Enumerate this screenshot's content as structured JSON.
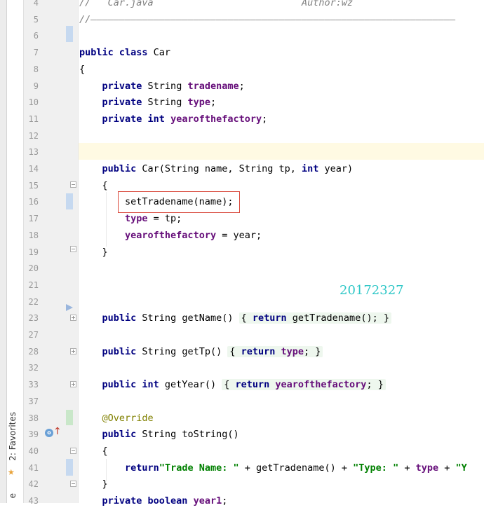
{
  "sidebar": {
    "favorites_label": "2: Favorites",
    "edge_label": "e"
  },
  "watermark": "20172327",
  "lines": [
    {
      "n": "4",
      "html": "<span class=\"cmt\">//   Car.java                          Author:wz</span>"
    },
    {
      "n": "5",
      "html": "<span class=\"cmt\">//————————————————————————————————————————————————————————————————</span>"
    },
    {
      "n": "6",
      "html": ""
    },
    {
      "n": "7",
      "html": "<span class=\"kw\">public class</span> Car"
    },
    {
      "n": "8",
      "html": "{"
    },
    {
      "n": "9",
      "html": "    <span class=\"kw\">private</span> String <span class=\"fld\">tradename</span>;"
    },
    {
      "n": "10",
      "html": "    <span class=\"kw\">private</span> String <span class=\"fld\">type</span>;"
    },
    {
      "n": "11",
      "html": "    <span class=\"kw\">private int</span> <span class=\"fld\">yearofthefactory</span>;"
    },
    {
      "n": "12",
      "html": ""
    },
    {
      "n": "13",
      "html": ""
    },
    {
      "n": "14",
      "html": "    <span class=\"kw\">public</span> Car(String name, String tp, <span class=\"kw\">int</span> year)"
    },
    {
      "n": "15",
      "html": "    {"
    },
    {
      "n": "16",
      "html": "        setTradename(name);"
    },
    {
      "n": "17",
      "html": "        <span class=\"fld\">type</span> = tp;"
    },
    {
      "n": "18",
      "html": "        <span class=\"fld\">yearofthefactory</span> = year;"
    },
    {
      "n": "19",
      "html": "    }"
    },
    {
      "n": "20",
      "html": ""
    },
    {
      "n": "21",
      "html": ""
    },
    {
      "n": "22",
      "html": ""
    },
    {
      "n": "23",
      "html": "    <span class=\"kw\">public</span> String getName() <span class=\"collapsed\">{ <span class=\"kw\">return</span> getTradename(); }</span>"
    },
    {
      "n": "27",
      "html": ""
    },
    {
      "n": "28",
      "html": "    <span class=\"kw\">public</span> String getTp() <span class=\"collapsed\">{ <span class=\"kw\">return</span> <span class=\"fld\">type</span>; }</span>"
    },
    {
      "n": "32",
      "html": ""
    },
    {
      "n": "33",
      "html": "    <span class=\"kw\">public int</span> getYear() <span class=\"collapsed\">{ <span class=\"kw\">return</span> <span class=\"fld\">yearofthefactory</span>; }</span>"
    },
    {
      "n": "37",
      "html": ""
    },
    {
      "n": "38",
      "html": "    <span class=\"ann\">@Override</span>"
    },
    {
      "n": "39",
      "html": "    <span class=\"kw\">public</span> String toString()"
    },
    {
      "n": "40",
      "html": "    {"
    },
    {
      "n": "41",
      "html": "        <span class=\"kw\">return</span><span class=\"str\">\"Trade Name: \"</span> + getTradename() + <span class=\"str\">\"Type: \"</span> + <span class=\"fld\">type</span> + <span class=\"str\">\"Y</span>"
    },
    {
      "n": "42",
      "html": "    }"
    },
    {
      "n": "43",
      "html": "    <span class=\"kw\">private boolean</span> <span class=\"fld\">year1</span>;"
    }
  ]
}
